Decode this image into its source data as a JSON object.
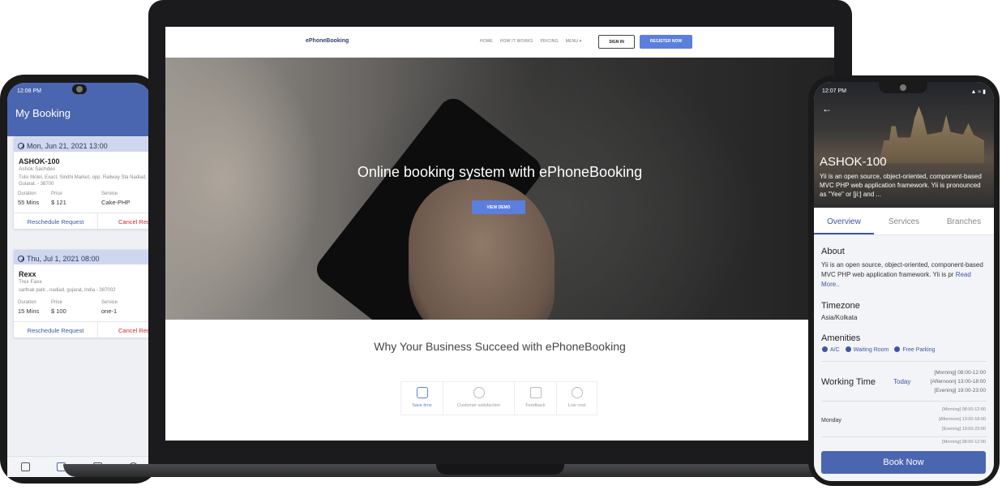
{
  "left_phone": {
    "time": "12:08 PM",
    "title": "My Booking",
    "bookings": [
      {
        "date": "Mon, Jun 21, 2021 13:00",
        "name": "ASHOK-100",
        "person": "Ashok Sachdev",
        "address": "Tulsi Motel, Exact, Sindhi Market, opp. Railway Sta Nadiad, Gujarat, - 38700",
        "duration_label": "Duration",
        "duration": "55 Mins",
        "price_label": "Price",
        "price": "$ 121",
        "service_label": "Service",
        "service": "Cake-PHP",
        "reschedule": "Reschedule Request",
        "cancel": "Cancel Req"
      },
      {
        "date": "Thu, Jul 1, 2021 08:00",
        "name": "Rexx",
        "person": "Trex Faxx",
        "address": "sarthak park , nadiad, gujarat, India - 387002",
        "duration_label": "Duration",
        "duration": "15 Mins",
        "price_label": "Price",
        "price": "$ 100",
        "service_label": "Service",
        "service": "one-1",
        "reschedule": "Reschedule Request",
        "cancel": "Cancel Req"
      }
    ]
  },
  "website": {
    "logo": "ePhoneBooking",
    "nav": [
      "HOME",
      "HOW IT WORKS",
      "PRICING",
      "MENU ▾"
    ],
    "signin": "SIGN IN",
    "register": "REGISTER NOW",
    "hero_title": "Online booking system with ePhoneBooking",
    "demo_button": "VIEW DEMO",
    "why_title": "Why Your Business Succeed with ePhoneBooking",
    "features": [
      "Save time",
      "Customer satisfaction",
      "Feedback",
      "Low cost"
    ]
  },
  "right_phone": {
    "time": "12:07 PM",
    "title": "ASHOK-100",
    "description": "Yii is an open source, object-oriented, component-based MVC PHP web application framework. Yii is pronounced as \"Yee\" or [ji:] and ...",
    "tabs": [
      "Overview",
      "Services",
      "Branches"
    ],
    "about_heading": "About",
    "about_text": "Yii is an open source, object-oriented, component-based MVC PHP web application framework. Yii is pr",
    "read_more": "Read More..",
    "timezone_heading": "Timezone",
    "timezone": "Asia/Kolkata",
    "amenities_heading": "Amenities",
    "amenities": [
      "A/C",
      "Waiting Room",
      "Free Parking"
    ],
    "working_time_heading": "Working Time",
    "today_label": "Today",
    "today_slots": [
      "[Morning]  08:00-12:00",
      "[Afternoon]  13:00-18:00",
      "[Evening]  19:00-23:00"
    ],
    "monday_label": "Monday",
    "monday_slots": [
      "[Morning]  08:00-12:00",
      "[Afternoon]  13:00-18:00",
      "[Evening]  19:00-23:00",
      "[Morning]  08:00-12:00"
    ],
    "book_button": "Book Now"
  }
}
